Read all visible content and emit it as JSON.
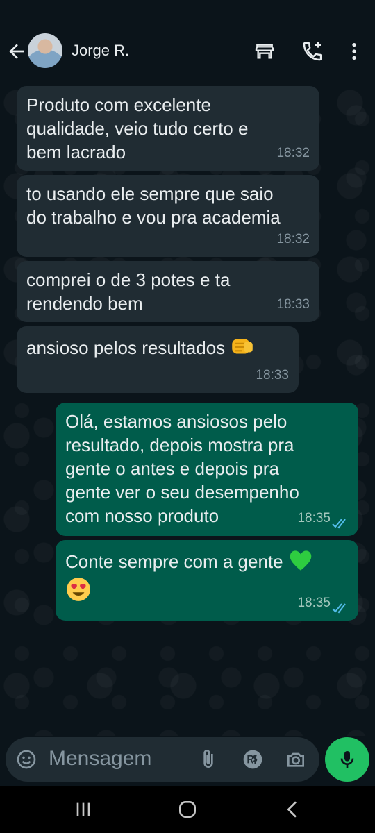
{
  "header": {
    "contact_name": "Jorge R.",
    "icons": [
      "back-arrow-icon",
      "catalog-store-icon",
      "add-call-icon",
      "more-vert-icon"
    ]
  },
  "messages": [
    {
      "direction": "in",
      "text": "Produto com excelente\nqualidade, veio tudo certo e\nbem lacrado",
      "time": "18:32"
    },
    {
      "direction": "in",
      "text": "to usando ele sempre que saio\ndo trabalho e vou pra academia",
      "time": "18:32"
    },
    {
      "direction": "in",
      "text": "comprei o de 3 potes e ta\nrendendo bem",
      "time": "18:33"
    },
    {
      "direction": "in",
      "text": "ansioso pelos resultados",
      "emoji": "fist-bump-emoji",
      "time": "18:33"
    },
    {
      "direction": "out",
      "text": "Olá, estamos ansiosos pelo\nresultado, depois mostra pra\ngente o antes e depois pra\ngente ver o seu desempenho\ncom nosso produto",
      "time": "18:35",
      "status": "read"
    },
    {
      "direction": "out",
      "text": "Conte sempre com a gente",
      "emoji": "green-heart-emoji",
      "emoji2": "heart-eyes-emoji",
      "time": "18:35",
      "status": "read"
    }
  ],
  "composer": {
    "placeholder": "Mensagem",
    "icons": [
      "emoji-icon",
      "attach-icon",
      "payment-icon",
      "camera-icon",
      "mic-icon"
    ]
  },
  "colors": {
    "background": "#0b141a",
    "incoming_bubble": "#202c33",
    "outgoing_bubble": "#005c4b",
    "accent": "#21c063",
    "read_ticks": "#53bdeb"
  }
}
